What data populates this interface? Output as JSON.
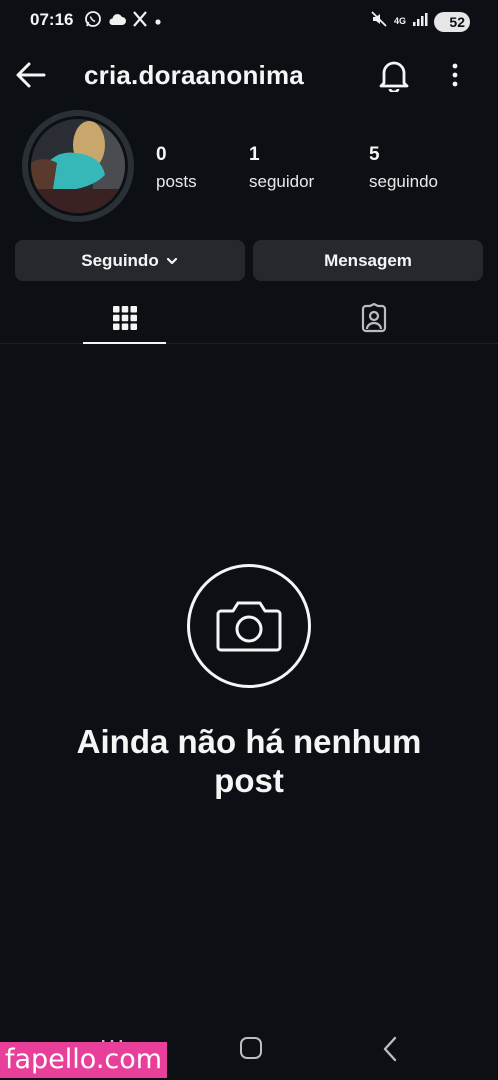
{
  "status_bar": {
    "time": "07:16",
    "notif_icons": [
      "whatsapp-icon",
      "cloud-icon",
      "x-icon",
      "dot-icon"
    ],
    "network": "4G",
    "battery": "52"
  },
  "header": {
    "username": "cria.doraanonima",
    "back_icon": "arrow-left-icon",
    "bell_icon": "bell-icon",
    "more_icon": "more-vertical-icon"
  },
  "profile": {
    "posts": {
      "count": "0",
      "label": "posts"
    },
    "followers": {
      "count": "1",
      "label": "seguidor"
    },
    "following": {
      "count": "5",
      "label": "seguindo"
    }
  },
  "actions": {
    "following_label": "Seguindo",
    "message_label": "Mensagem"
  },
  "tabs": [
    {
      "name": "grid",
      "icon": "grid-icon",
      "active": true
    },
    {
      "name": "tagged",
      "icon": "tagged-person-icon",
      "active": false
    }
  ],
  "empty_state": {
    "icon": "camera-icon",
    "title": "Ainda não há nenhum post"
  },
  "watermark": "fapello.com",
  "colors": {
    "background": "#0c1014",
    "button": "#25292e",
    "text": "#f5f5f5",
    "watermark": "#e8409a"
  }
}
